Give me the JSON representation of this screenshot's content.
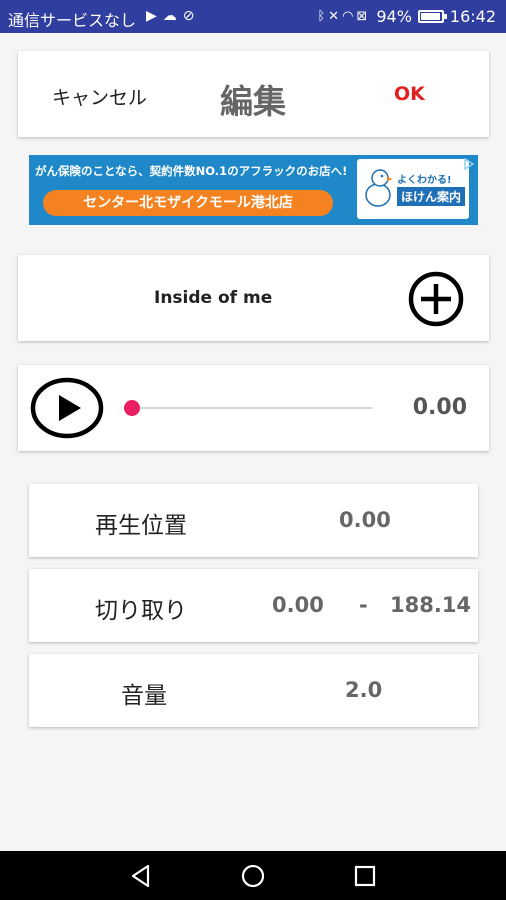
{
  "status_bar": {
    "carrier": "通信サービスなし",
    "left_icons": [
      "play-store-icon",
      "cloud-icon",
      "signal-off-icon"
    ],
    "right_icons": [
      "bluetooth-icon",
      "mute-icon",
      "wifi-icon",
      "no-signal-icon"
    ],
    "battery_percent": "94%",
    "battery_level": 0.94,
    "time": "16:42"
  },
  "header": {
    "cancel_label": "キャンセル",
    "title": "編集",
    "ok_label": "OK",
    "ok_color": "#e02020"
  },
  "ad": {
    "top_text": "がん保険のことなら、契約件数NO.1のアフラックのお店へ!",
    "pill_text": "センター北モザイクモール港北店",
    "right_line1": "よくわかる!",
    "right_line2": "ほけん案内",
    "colors": {
      "background": "#1e88c8",
      "pill": "#f58220"
    }
  },
  "song": {
    "name": "Inside of me",
    "add_icon": "plus-circle-icon"
  },
  "player": {
    "play_icon": "play-icon",
    "position": 0.0,
    "current_time": "0.00",
    "accent_color": "#e91e63"
  },
  "settings": {
    "playback_position": {
      "label": "再生位置",
      "value": "0.00"
    },
    "trim": {
      "label": "切り取り",
      "start": "0.00",
      "separator": "-",
      "end": "188.14"
    },
    "volume": {
      "label": "音量",
      "value": "2.0"
    }
  },
  "nav": {
    "icons": [
      "back-icon",
      "home-icon",
      "recents-icon"
    ]
  }
}
